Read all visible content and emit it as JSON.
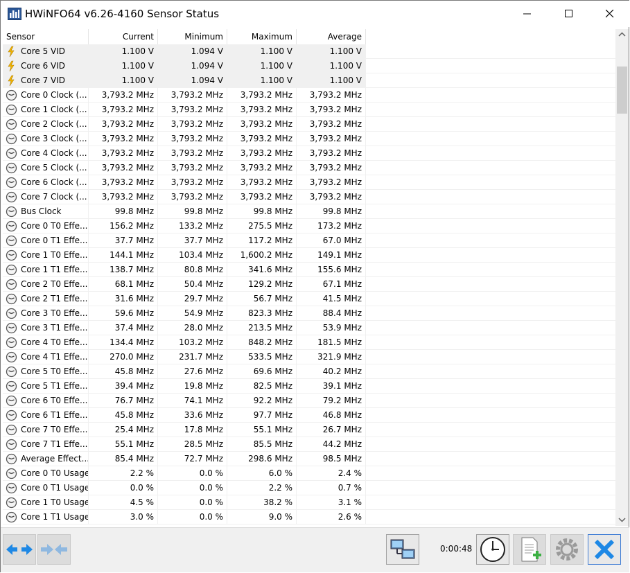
{
  "window": {
    "title": "HWiNFO64 v6.26-4160 Sensor Status"
  },
  "table": {
    "columns": [
      "Sensor",
      "Current",
      "Minimum",
      "Maximum",
      "Average"
    ],
    "rows": [
      {
        "icon": "voltage-icon",
        "sensor": "Core 5 VID",
        "current": "1.100 V",
        "minimum": "1.094 V",
        "maximum": "1.100 V",
        "average": "1.100 V"
      },
      {
        "icon": "voltage-icon",
        "sensor": "Core 6 VID",
        "current": "1.100 V",
        "minimum": "1.094 V",
        "maximum": "1.100 V",
        "average": "1.100 V"
      },
      {
        "icon": "voltage-icon",
        "sensor": "Core 7 VID",
        "current": "1.100 V",
        "minimum": "1.094 V",
        "maximum": "1.100 V",
        "average": "1.100 V"
      },
      {
        "icon": "clock-icon",
        "sensor": "Core 0 Clock (...",
        "current": "3,793.2 MHz",
        "minimum": "3,793.2 MHz",
        "maximum": "3,793.2 MHz",
        "average": "3,793.2 MHz"
      },
      {
        "icon": "clock-icon",
        "sensor": "Core 1 Clock (...",
        "current": "3,793.2 MHz",
        "minimum": "3,793.2 MHz",
        "maximum": "3,793.2 MHz",
        "average": "3,793.2 MHz"
      },
      {
        "icon": "clock-icon",
        "sensor": "Core 2 Clock (...",
        "current": "3,793.2 MHz",
        "minimum": "3,793.2 MHz",
        "maximum": "3,793.2 MHz",
        "average": "3,793.2 MHz"
      },
      {
        "icon": "clock-icon",
        "sensor": "Core 3 Clock (...",
        "current": "3,793.2 MHz",
        "minimum": "3,793.2 MHz",
        "maximum": "3,793.2 MHz",
        "average": "3,793.2 MHz"
      },
      {
        "icon": "clock-icon",
        "sensor": "Core 4 Clock (...",
        "current": "3,793.2 MHz",
        "minimum": "3,793.2 MHz",
        "maximum": "3,793.2 MHz",
        "average": "3,793.2 MHz"
      },
      {
        "icon": "clock-icon",
        "sensor": "Core 5 Clock (...",
        "current": "3,793.2 MHz",
        "minimum": "3,793.2 MHz",
        "maximum": "3,793.2 MHz",
        "average": "3,793.2 MHz"
      },
      {
        "icon": "clock-icon",
        "sensor": "Core 6 Clock (...",
        "current": "3,793.2 MHz",
        "minimum": "3,793.2 MHz",
        "maximum": "3,793.2 MHz",
        "average": "3,793.2 MHz"
      },
      {
        "icon": "clock-icon",
        "sensor": "Core 7 Clock (...",
        "current": "3,793.2 MHz",
        "minimum": "3,793.2 MHz",
        "maximum": "3,793.2 MHz",
        "average": "3,793.2 MHz"
      },
      {
        "icon": "clock-icon",
        "sensor": "Bus Clock",
        "current": "99.8 MHz",
        "minimum": "99.8 MHz",
        "maximum": "99.8 MHz",
        "average": "99.8 MHz"
      },
      {
        "icon": "clock-icon",
        "sensor": "Core 0 T0 Effe...",
        "current": "156.2 MHz",
        "minimum": "133.2 MHz",
        "maximum": "275.5 MHz",
        "average": "173.2 MHz"
      },
      {
        "icon": "clock-icon",
        "sensor": "Core 0 T1 Effe...",
        "current": "37.7 MHz",
        "minimum": "37.7 MHz",
        "maximum": "117.2 MHz",
        "average": "67.0 MHz"
      },
      {
        "icon": "clock-icon",
        "sensor": "Core 1 T0 Effe...",
        "current": "144.1 MHz",
        "minimum": "103.4 MHz",
        "maximum": "1,600.2 MHz",
        "average": "149.1 MHz"
      },
      {
        "icon": "clock-icon",
        "sensor": "Core 1 T1 Effe...",
        "current": "138.7 MHz",
        "minimum": "80.8 MHz",
        "maximum": "341.6 MHz",
        "average": "155.6 MHz"
      },
      {
        "icon": "clock-icon",
        "sensor": "Core 2 T0 Effe...",
        "current": "68.1 MHz",
        "minimum": "50.4 MHz",
        "maximum": "129.2 MHz",
        "average": "67.1 MHz"
      },
      {
        "icon": "clock-icon",
        "sensor": "Core 2 T1 Effe...",
        "current": "31.6 MHz",
        "minimum": "29.7 MHz",
        "maximum": "56.7 MHz",
        "average": "41.5 MHz"
      },
      {
        "icon": "clock-icon",
        "sensor": "Core 3 T0 Effe...",
        "current": "59.6 MHz",
        "minimum": "54.9 MHz",
        "maximum": "823.3 MHz",
        "average": "88.4 MHz"
      },
      {
        "icon": "clock-icon",
        "sensor": "Core 3 T1 Effe...",
        "current": "37.4 MHz",
        "minimum": "28.0 MHz",
        "maximum": "213.5 MHz",
        "average": "53.9 MHz"
      },
      {
        "icon": "clock-icon",
        "sensor": "Core 4 T0 Effe...",
        "current": "134.4 MHz",
        "minimum": "103.2 MHz",
        "maximum": "848.2 MHz",
        "average": "181.5 MHz"
      },
      {
        "icon": "clock-icon",
        "sensor": "Core 4 T1 Effe...",
        "current": "270.0 MHz",
        "minimum": "231.7 MHz",
        "maximum": "533.5 MHz",
        "average": "321.9 MHz"
      },
      {
        "icon": "clock-icon",
        "sensor": "Core 5 T0 Effe...",
        "current": "45.8 MHz",
        "minimum": "27.6 MHz",
        "maximum": "69.6 MHz",
        "average": "40.2 MHz"
      },
      {
        "icon": "clock-icon",
        "sensor": "Core 5 T1 Effe...",
        "current": "39.4 MHz",
        "minimum": "19.8 MHz",
        "maximum": "82.5 MHz",
        "average": "39.1 MHz"
      },
      {
        "icon": "clock-icon",
        "sensor": "Core 6 T0 Effe...",
        "current": "76.7 MHz",
        "minimum": "74.1 MHz",
        "maximum": "92.2 MHz",
        "average": "79.2 MHz"
      },
      {
        "icon": "clock-icon",
        "sensor": "Core 6 T1 Effe...",
        "current": "45.8 MHz",
        "minimum": "33.6 MHz",
        "maximum": "97.7 MHz",
        "average": "46.8 MHz"
      },
      {
        "icon": "clock-icon",
        "sensor": "Core 7 T0 Effe...",
        "current": "25.4 MHz",
        "minimum": "17.8 MHz",
        "maximum": "55.1 MHz",
        "average": "26.7 MHz"
      },
      {
        "icon": "clock-icon",
        "sensor": "Core 7 T1 Effe...",
        "current": "55.1 MHz",
        "minimum": "28.5 MHz",
        "maximum": "85.5 MHz",
        "average": "44.2 MHz"
      },
      {
        "icon": "clock-icon",
        "sensor": "Average Effect...",
        "current": "85.4 MHz",
        "minimum": "72.7 MHz",
        "maximum": "298.6 MHz",
        "average": "98.5 MHz"
      },
      {
        "icon": "clock-icon",
        "sensor": "Core 0 T0 Usage",
        "current": "2.2 %",
        "minimum": "0.0 %",
        "maximum": "6.0 %",
        "average": "2.4 %"
      },
      {
        "icon": "clock-icon",
        "sensor": "Core 0 T1 Usage",
        "current": "0.0 %",
        "minimum": "0.0 %",
        "maximum": "2.2 %",
        "average": "0.7 %"
      },
      {
        "icon": "clock-icon",
        "sensor": "Core 1 T0 Usage",
        "current": "4.5 %",
        "minimum": "0.0 %",
        "maximum": "38.2 %",
        "average": "3.1 %"
      },
      {
        "icon": "clock-icon",
        "sensor": "Core 1 T1 Usage",
        "current": "3.0 %",
        "minimum": "0.0 %",
        "maximum": "9.0 %",
        "average": "2.6 %"
      }
    ]
  },
  "toolbar": {
    "elapsed_time": "0:00:48",
    "icons": [
      "navigate-arrows-icon",
      "collapse-arrows-icon",
      "network-icon",
      "clock-reset-icon",
      "add-report-icon",
      "settings-icon",
      "close-icon"
    ]
  },
  "colors": {
    "selected_row": "#f0f0f0",
    "grid_line": "#f0f0f0",
    "accent_blue": "#1e90ff"
  }
}
